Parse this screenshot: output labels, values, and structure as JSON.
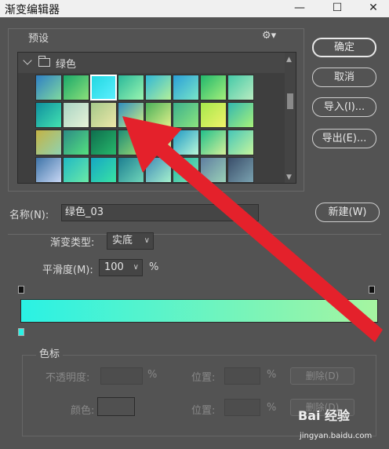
{
  "window": {
    "title": "渐变编辑器",
    "minimize_glyph": "—",
    "maximize_glyph": "☐",
    "close_glyph": "✕"
  },
  "presets": {
    "label": "预设",
    "gear_icon": "gear-icon",
    "folder_name": "绿色",
    "swatches": [
      {
        "c1": "#2f7fc4",
        "c2": "#7fd9a0"
      },
      {
        "c1": "#1aa86a",
        "c2": "#8be07a"
      },
      {
        "c1": "#20d6e0",
        "c2": "#5df0ff"
      },
      {
        "c1": "#2ab89a",
        "c2": "#9af5b0"
      },
      {
        "c1": "#30b7d6",
        "c2": "#b3f09a"
      },
      {
        "c1": "#2a9fd8",
        "c2": "#79e6c8"
      },
      {
        "c1": "#21b76d",
        "c2": "#a4ef7b"
      },
      {
        "c1": "#45c9a8",
        "c2": "#b9ecc0"
      },
      {
        "c1": "#0f8f9f",
        "c2": "#43e2b0"
      },
      {
        "c1": "#a9d4c4",
        "c2": "#e7f3d7"
      },
      {
        "c1": "#a5c98a",
        "c2": "#ede7a8"
      },
      {
        "c1": "#2e8ec0",
        "c2": "#d2f07f"
      },
      {
        "c1": "#49b05a",
        "c2": "#e0f08a"
      },
      {
        "c1": "#3cb08d",
        "c2": "#8be57e"
      },
      {
        "c1": "#a5e84c",
        "c2": "#f0f26a"
      },
      {
        "c1": "#32b7b0",
        "c2": "#a8f27a"
      },
      {
        "c1": "#c4b345",
        "c2": "#8fd3b1"
      },
      {
        "c1": "#2c8c86",
        "c2": "#54e07f"
      },
      {
        "c1": "#0e6e4e",
        "c2": "#27b86b"
      },
      {
        "c1": "#1d8c76",
        "c2": "#9fdc73"
      },
      {
        "c1": "#3cb3d0",
        "c2": "#f2ee88"
      },
      {
        "c1": "#1f99c4",
        "c2": "#b8f7d8"
      },
      {
        "c1": "#22c08b",
        "c2": "#d4f09a"
      },
      {
        "c1": "#46c6b8",
        "c2": "#c6f59d"
      },
      {
        "c1": "#3e74a8",
        "c2": "#c7d6f3"
      },
      {
        "c1": "#20b9c4",
        "c2": "#6ae9a7"
      },
      {
        "c1": "#15a7c4",
        "c2": "#39e3a4"
      },
      {
        "c1": "#1d7f91",
        "c2": "#6fd5b9"
      },
      {
        "c1": "#3f8bb7",
        "c2": "#a4f0cc"
      },
      {
        "c1": "#22b9a5",
        "c2": "#7ce2b3"
      },
      {
        "c1": "#5f7ea0",
        "c2": "#9ad1b8"
      },
      {
        "c1": "#3a4e6a",
        "c2": "#7aa2b0"
      }
    ],
    "selected_index": 2
  },
  "buttons": {
    "ok": "确定",
    "cancel": "取消",
    "import": "导入(I)...",
    "export": "导出(E)...",
    "new": "新建(W)"
  },
  "name_field": {
    "label": "名称(N):",
    "value": "绿色_03"
  },
  "gradient": {
    "type_label": "渐变类型:",
    "type_value": "实底",
    "smoothness_label": "平滑度(M):",
    "smoothness_value": "100",
    "smoothness_unit": "%",
    "start_color": "#2af2e4",
    "end_color": "#a6f5a0"
  },
  "color_stops": {
    "group_label": "色标",
    "opacity_label": "不透明度:",
    "opacity_unit": "%",
    "position_label_1": "位置:",
    "position_unit_1": "%",
    "delete_label_1": "删除(D)",
    "color_label": "颜色:",
    "position_label_2": "位置:",
    "position_unit_2": "%",
    "delete_label_2": "删除(D)"
  },
  "watermark": {
    "logo": "Bai 经验",
    "url": "jingyan.baidu.com"
  },
  "arrow_color": "#e4212b"
}
